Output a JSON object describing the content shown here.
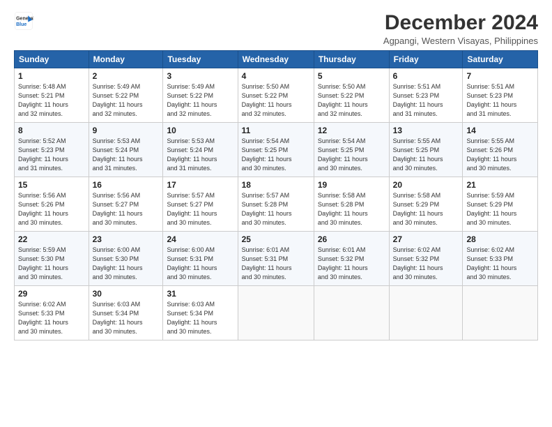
{
  "logo": {
    "line1": "General",
    "line2": "Blue"
  },
  "title": "December 2024",
  "subtitle": "Agpangi, Western Visayas, Philippines",
  "days_header": [
    "Sunday",
    "Monday",
    "Tuesday",
    "Wednesday",
    "Thursday",
    "Friday",
    "Saturday"
  ],
  "weeks": [
    [
      {
        "day": "1",
        "info": "Sunrise: 5:48 AM\nSunset: 5:21 PM\nDaylight: 11 hours\nand 32 minutes."
      },
      {
        "day": "2",
        "info": "Sunrise: 5:49 AM\nSunset: 5:22 PM\nDaylight: 11 hours\nand 32 minutes."
      },
      {
        "day": "3",
        "info": "Sunrise: 5:49 AM\nSunset: 5:22 PM\nDaylight: 11 hours\nand 32 minutes."
      },
      {
        "day": "4",
        "info": "Sunrise: 5:50 AM\nSunset: 5:22 PM\nDaylight: 11 hours\nand 32 minutes."
      },
      {
        "day": "5",
        "info": "Sunrise: 5:50 AM\nSunset: 5:22 PM\nDaylight: 11 hours\nand 32 minutes."
      },
      {
        "day": "6",
        "info": "Sunrise: 5:51 AM\nSunset: 5:23 PM\nDaylight: 11 hours\nand 31 minutes."
      },
      {
        "day": "7",
        "info": "Sunrise: 5:51 AM\nSunset: 5:23 PM\nDaylight: 11 hours\nand 31 minutes."
      }
    ],
    [
      {
        "day": "8",
        "info": "Sunrise: 5:52 AM\nSunset: 5:23 PM\nDaylight: 11 hours\nand 31 minutes."
      },
      {
        "day": "9",
        "info": "Sunrise: 5:53 AM\nSunset: 5:24 PM\nDaylight: 11 hours\nand 31 minutes."
      },
      {
        "day": "10",
        "info": "Sunrise: 5:53 AM\nSunset: 5:24 PM\nDaylight: 11 hours\nand 31 minutes."
      },
      {
        "day": "11",
        "info": "Sunrise: 5:54 AM\nSunset: 5:25 PM\nDaylight: 11 hours\nand 30 minutes."
      },
      {
        "day": "12",
        "info": "Sunrise: 5:54 AM\nSunset: 5:25 PM\nDaylight: 11 hours\nand 30 minutes."
      },
      {
        "day": "13",
        "info": "Sunrise: 5:55 AM\nSunset: 5:25 PM\nDaylight: 11 hours\nand 30 minutes."
      },
      {
        "day": "14",
        "info": "Sunrise: 5:55 AM\nSunset: 5:26 PM\nDaylight: 11 hours\nand 30 minutes."
      }
    ],
    [
      {
        "day": "15",
        "info": "Sunrise: 5:56 AM\nSunset: 5:26 PM\nDaylight: 11 hours\nand 30 minutes."
      },
      {
        "day": "16",
        "info": "Sunrise: 5:56 AM\nSunset: 5:27 PM\nDaylight: 11 hours\nand 30 minutes."
      },
      {
        "day": "17",
        "info": "Sunrise: 5:57 AM\nSunset: 5:27 PM\nDaylight: 11 hours\nand 30 minutes."
      },
      {
        "day": "18",
        "info": "Sunrise: 5:57 AM\nSunset: 5:28 PM\nDaylight: 11 hours\nand 30 minutes."
      },
      {
        "day": "19",
        "info": "Sunrise: 5:58 AM\nSunset: 5:28 PM\nDaylight: 11 hours\nand 30 minutes."
      },
      {
        "day": "20",
        "info": "Sunrise: 5:58 AM\nSunset: 5:29 PM\nDaylight: 11 hours\nand 30 minutes."
      },
      {
        "day": "21",
        "info": "Sunrise: 5:59 AM\nSunset: 5:29 PM\nDaylight: 11 hours\nand 30 minutes."
      }
    ],
    [
      {
        "day": "22",
        "info": "Sunrise: 5:59 AM\nSunset: 5:30 PM\nDaylight: 11 hours\nand 30 minutes."
      },
      {
        "day": "23",
        "info": "Sunrise: 6:00 AM\nSunset: 5:30 PM\nDaylight: 11 hours\nand 30 minutes."
      },
      {
        "day": "24",
        "info": "Sunrise: 6:00 AM\nSunset: 5:31 PM\nDaylight: 11 hours\nand 30 minutes."
      },
      {
        "day": "25",
        "info": "Sunrise: 6:01 AM\nSunset: 5:31 PM\nDaylight: 11 hours\nand 30 minutes."
      },
      {
        "day": "26",
        "info": "Sunrise: 6:01 AM\nSunset: 5:32 PM\nDaylight: 11 hours\nand 30 minutes."
      },
      {
        "day": "27",
        "info": "Sunrise: 6:02 AM\nSunset: 5:32 PM\nDaylight: 11 hours\nand 30 minutes."
      },
      {
        "day": "28",
        "info": "Sunrise: 6:02 AM\nSunset: 5:33 PM\nDaylight: 11 hours\nand 30 minutes."
      }
    ],
    [
      {
        "day": "29",
        "info": "Sunrise: 6:02 AM\nSunset: 5:33 PM\nDaylight: 11 hours\nand 30 minutes."
      },
      {
        "day": "30",
        "info": "Sunrise: 6:03 AM\nSunset: 5:34 PM\nDaylight: 11 hours\nand 30 minutes."
      },
      {
        "day": "31",
        "info": "Sunrise: 6:03 AM\nSunset: 5:34 PM\nDaylight: 11 hours\nand 30 minutes."
      },
      null,
      null,
      null,
      null
    ]
  ]
}
